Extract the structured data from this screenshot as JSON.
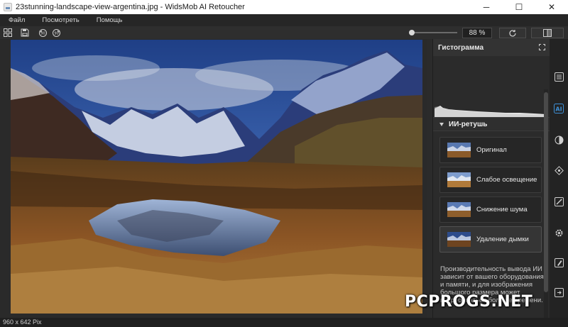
{
  "window": {
    "title": "23stunning-landscape-view-argentina.jpg - WidsMob AI Retoucher",
    "minimize_glyph": "─",
    "maximize_glyph": "☐",
    "close_glyph": "✕"
  },
  "menu": {
    "items": [
      "Файл",
      "Посмотреть",
      "Помощь"
    ]
  },
  "toolbar": {
    "icons": [
      "grid-icon",
      "save-icon",
      "rotate-left-icon",
      "rotate-right-icon"
    ],
    "zoom_value": "88 %",
    "zoom_level": 0.0,
    "actions": [
      "refresh-icon",
      "compare-icon"
    ]
  },
  "status": {
    "dimensions": "960 x 642 Pix"
  },
  "panel": {
    "histogram_title": "Гистограмма",
    "ai_section_title": "ИИ-ретушь",
    "presets": [
      {
        "label": "Оригинал",
        "active": false
      },
      {
        "label": "Слабое освещение",
        "active": false
      },
      {
        "label": "Снижение шума",
        "active": false
      },
      {
        "label": "Удаление дымки",
        "active": true
      }
    ],
    "note": "Производительность вывода ИИ зависит от вашего оборудования и памяти, и для изображения большого размера может потребоваться больше времени."
  },
  "tools": [
    "adjust-icon",
    "ai-icon",
    "color-icon",
    "shape-icon",
    "magic-icon",
    "settings-icon",
    "brush-icon",
    "export-icon"
  ],
  "watermark": "PCPROGS.NET",
  "colors": {
    "background": "#2b2b2b",
    "accent": "#3d8fd6",
    "titlebar": "#ffffff"
  }
}
